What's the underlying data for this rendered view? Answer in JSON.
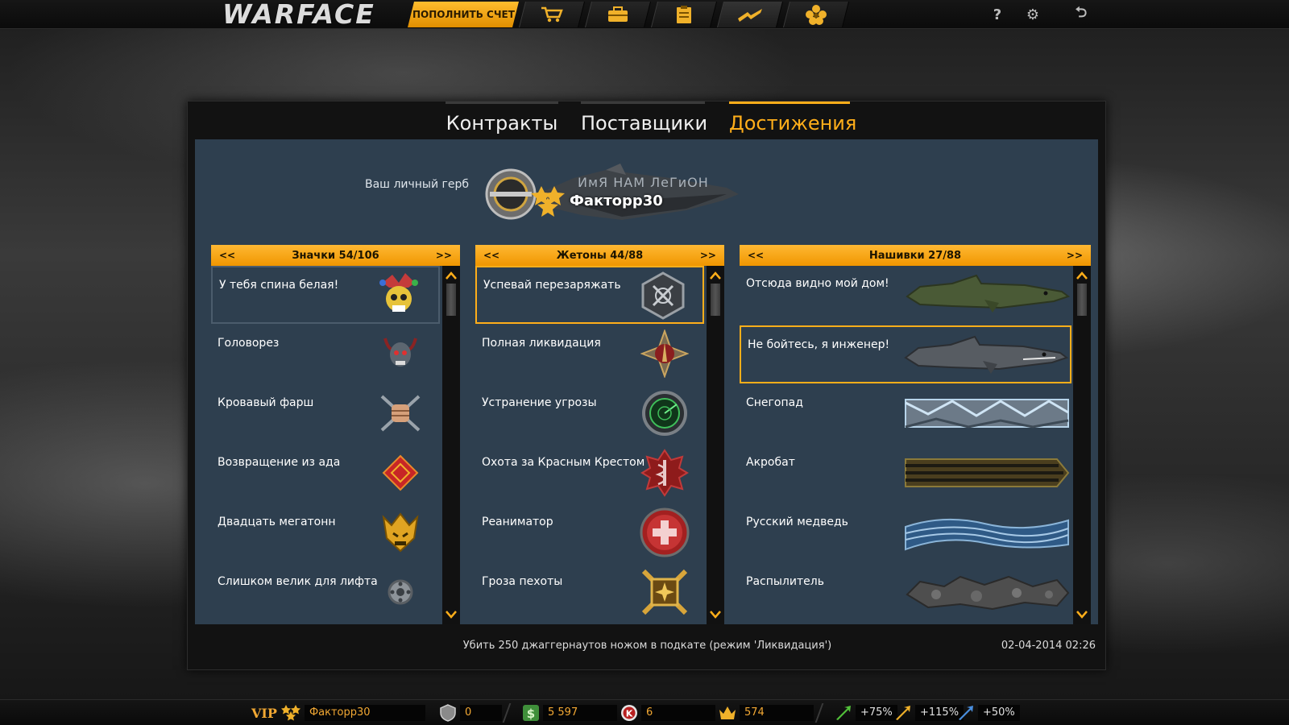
{
  "topbar": {
    "logo": "WARFACE",
    "topup_label": "ПОПОЛНИТЬ СЧЕТ",
    "nav_icons": [
      "shop-cart-icon",
      "inventory-box-icon",
      "contracts-clipboard-icon",
      "achievements-wings-icon",
      "clan-flower-icon"
    ],
    "help": "?",
    "settings": "⚙",
    "exit": "⮌"
  },
  "tabs": [
    {
      "label": "Контракты",
      "active": false
    },
    {
      "label": "Поставщики",
      "active": false
    },
    {
      "label": "Достижения",
      "active": true
    }
  ],
  "crest": {
    "label": "Ваш личный герб",
    "clan": "ИмЯ   НАМ   ЛеГиОН",
    "name": "Факторр30"
  },
  "columns": [
    {
      "title": "Значки 54/106",
      "prev": "<<",
      "next": ">>",
      "items": [
        {
          "label": "У тебя спина белая!",
          "icon": "jester-skull-icon"
        },
        {
          "label": "Головорез",
          "icon": "horned-skull-icon"
        },
        {
          "label": "Кровавый фарш",
          "icon": "fist-knives-icon"
        },
        {
          "label": "Возвращение из ада",
          "icon": "red-diamond-icon"
        },
        {
          "label": "Двадцать мегатонн",
          "icon": "gold-helmet-icon"
        },
        {
          "label": "Слишком велик для лифта",
          "icon": "gear-badge-icon"
        }
      ]
    },
    {
      "title": "Жетоны 44/88",
      "prev": "<<",
      "next": ">>",
      "items": [
        {
          "label": "Успевай перезаряжать",
          "icon": "hex-crosshair-token-icon"
        },
        {
          "label": "Полная ликвидация",
          "icon": "star-dagger-token-icon"
        },
        {
          "label": "Устранение угрозы",
          "icon": "green-radar-token-icon"
        },
        {
          "label": "Охота за Красным Крестом",
          "icon": "red-caduceus-token-icon"
        },
        {
          "label": "Реаниматор",
          "icon": "red-cross-token-icon"
        },
        {
          "label": "Гроза пехоты",
          "icon": "gold-cross-token-icon"
        }
      ]
    },
    {
      "title": "Нашивки 27/88",
      "prev": "<<",
      "next": ">>",
      "items": [
        {
          "label": "Отсюда видно мой дом!",
          "icon": "green-shark-patch-icon"
        },
        {
          "label": "Не бойтесь, я инженер!",
          "icon": "steel-shark-patch-icon"
        },
        {
          "label": "Снегопад",
          "icon": "ice-patch-icon"
        },
        {
          "label": "Акробат",
          "icon": "striped-ribbon-patch-icon"
        },
        {
          "label": "Русский медведь",
          "icon": "blue-wave-patch-icon"
        },
        {
          "label": "Распылитель",
          "icon": "rock-patch-icon"
        }
      ]
    }
  ],
  "footer": {
    "description": "Убить 250 джаггернаутов ножом в подкате (режим 'Ликвидация')",
    "date": "02-04-2014 02:26"
  },
  "bottombar": {
    "vip": "VIP",
    "player": "Факторр30",
    "shield": "0",
    "money": "5 597",
    "kredits": "6",
    "crowns": "574",
    "boost_xp": "+75%",
    "boost_money": "+115%",
    "boost_vp": "+50%"
  },
  "colors": {
    "accent": "#ffae1a",
    "content_bg": "#2e3f4f",
    "panel_bg": "#121212"
  }
}
